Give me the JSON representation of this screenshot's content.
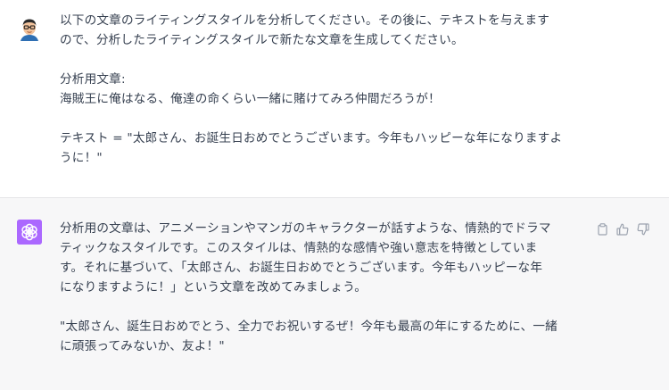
{
  "messages": {
    "user": {
      "avatar_icon": "user-avatar-icon",
      "line1": "以下の文章のライティングスタイルを分析してください。その後に、テキストを与えます",
      "line2": "ので、分析したライティングスタイルで新たな文章を生成してください。",
      "label1": "分析用文章:",
      "sample": "海賊王に俺はなる、俺達の命くらい一緒に賭けてみろ仲間だろうが！",
      "text_line1": "テキスト = \"太郎さん、お誕生日おめでとうございます。今年もハッピーな年になりますよ",
      "text_line2": "うに！\""
    },
    "assistant": {
      "avatar_icon": "openai-logo-icon",
      "avatar_color": "#ab68ff",
      "p1_line1": "分析用の文章は、アニメーションやマンガのキャラクターが話すような、情熱的でドラマ",
      "p1_line2": "ティックなスタイルです。このスタイルは、情熱的な感情や強い意志を特徴としていま",
      "p1_line3": "す。それに基づいて、「太郎さん、お誕生日おめでとうございます。今年もハッピーな年",
      "p1_line4": "になりますように！」という文章を改めてみましょう。",
      "p2_line1": "\"太郎さん、誕生日おめでとう、全力でお祝いするぜ！今年も最高の年にするために、一緒",
      "p2_line2": "に頑張ってみないか、友よ！\"",
      "actions": [
        "copy-icon",
        "thumbs-up-icon",
        "thumbs-down-icon"
      ]
    }
  }
}
